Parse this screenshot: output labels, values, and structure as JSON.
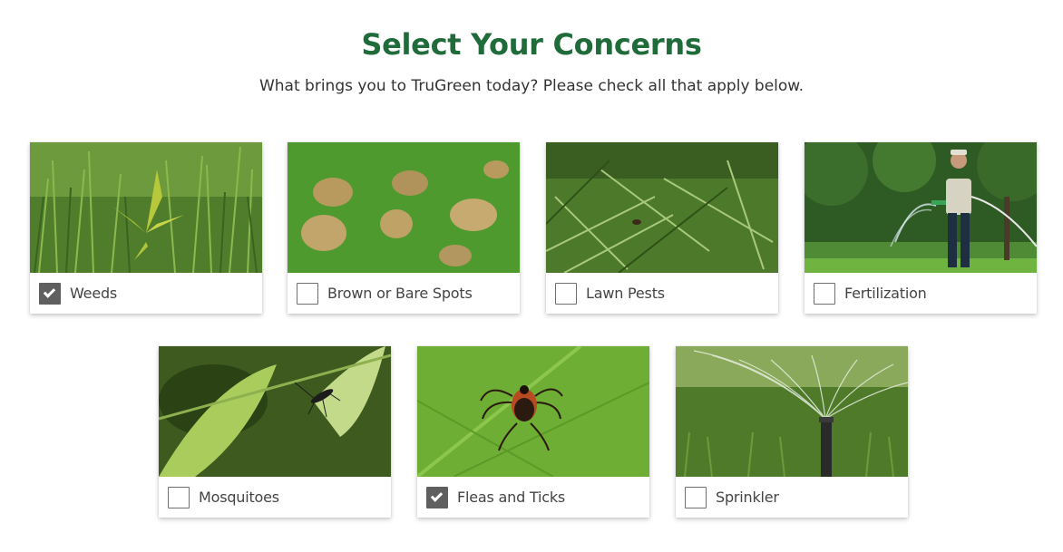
{
  "header": {
    "title": "Select Your Concerns",
    "subtitle": "What brings you to TruGreen today? Please check all that apply below."
  },
  "concerns": [
    {
      "label": "Weeds",
      "checked": true,
      "image": "weeds-photo"
    },
    {
      "label": "Brown or Bare Spots",
      "checked": false,
      "image": "brown-spots-photo"
    },
    {
      "label": "Lawn Pests",
      "checked": false,
      "image": "lawn-pests-photo"
    },
    {
      "label": "Fertilization",
      "checked": false,
      "image": "fertilization-photo"
    },
    {
      "label": "Mosquitoes",
      "checked": false,
      "image": "mosquito-photo"
    },
    {
      "label": "Fleas and Ticks",
      "checked": true,
      "image": "tick-photo"
    },
    {
      "label": "Sprinkler",
      "checked": false,
      "image": "sprinkler-photo"
    }
  ],
  "colors": {
    "title": "#1f6b3a",
    "checkbox_checked": "#5f5f5f",
    "checkbox_border": "#6f6f6f"
  }
}
